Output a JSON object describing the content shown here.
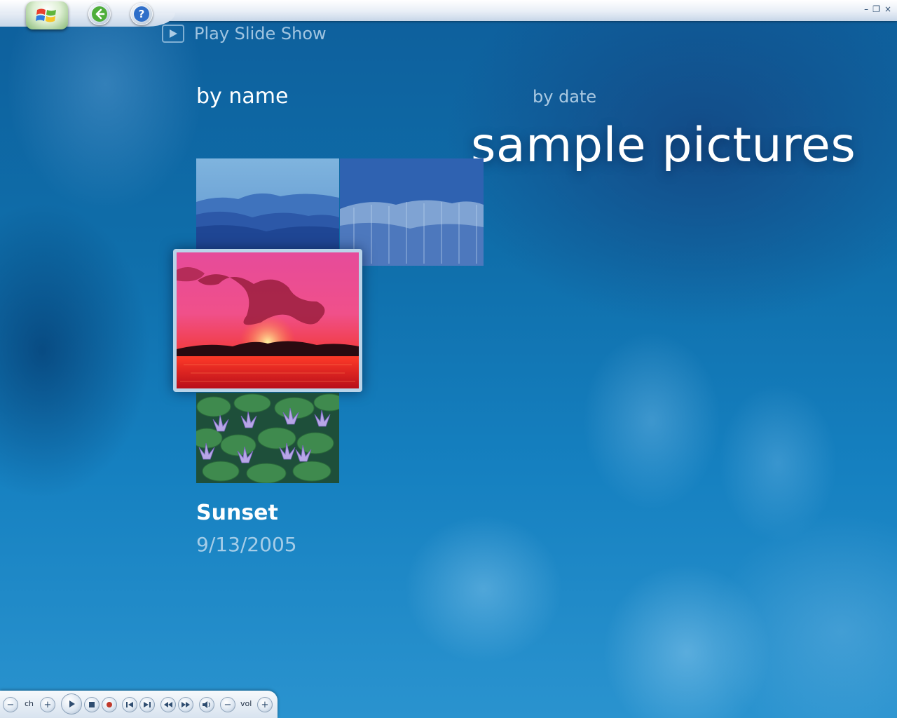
{
  "header": {
    "start_icon": "windows-flag-icon",
    "back_icon": "back-arrow-icon",
    "help_icon": "help-question-icon",
    "help_symbol": "?",
    "minimize_symbol": "–",
    "restore_symbol": "❐",
    "close_symbol": "×"
  },
  "slideshow": {
    "label": "Play Slide Show",
    "icon": "play-icon"
  },
  "sort": {
    "by_name": "by name",
    "by_date": "by date",
    "active": "by name"
  },
  "page": {
    "title": "sample pictures"
  },
  "gallery": {
    "items": [
      {
        "id": "mountains",
        "icon": "blue-mountains-image"
      },
      {
        "id": "winter",
        "icon": "winter-forest-image"
      },
      {
        "id": "sunset",
        "icon": "sunset-image"
      },
      {
        "id": "water-lilies",
        "icon": "water-lilies-image"
      }
    ],
    "focused": {
      "title": "Sunset",
      "date": "9/13/2005"
    }
  },
  "transport": {
    "ch_label": "ch",
    "vol_label": "vol",
    "minus": "−",
    "plus": "+"
  },
  "colors": {
    "background": "#0f6eaa",
    "text_primary": "#ffffff",
    "text_secondary": "#c8def0"
  }
}
